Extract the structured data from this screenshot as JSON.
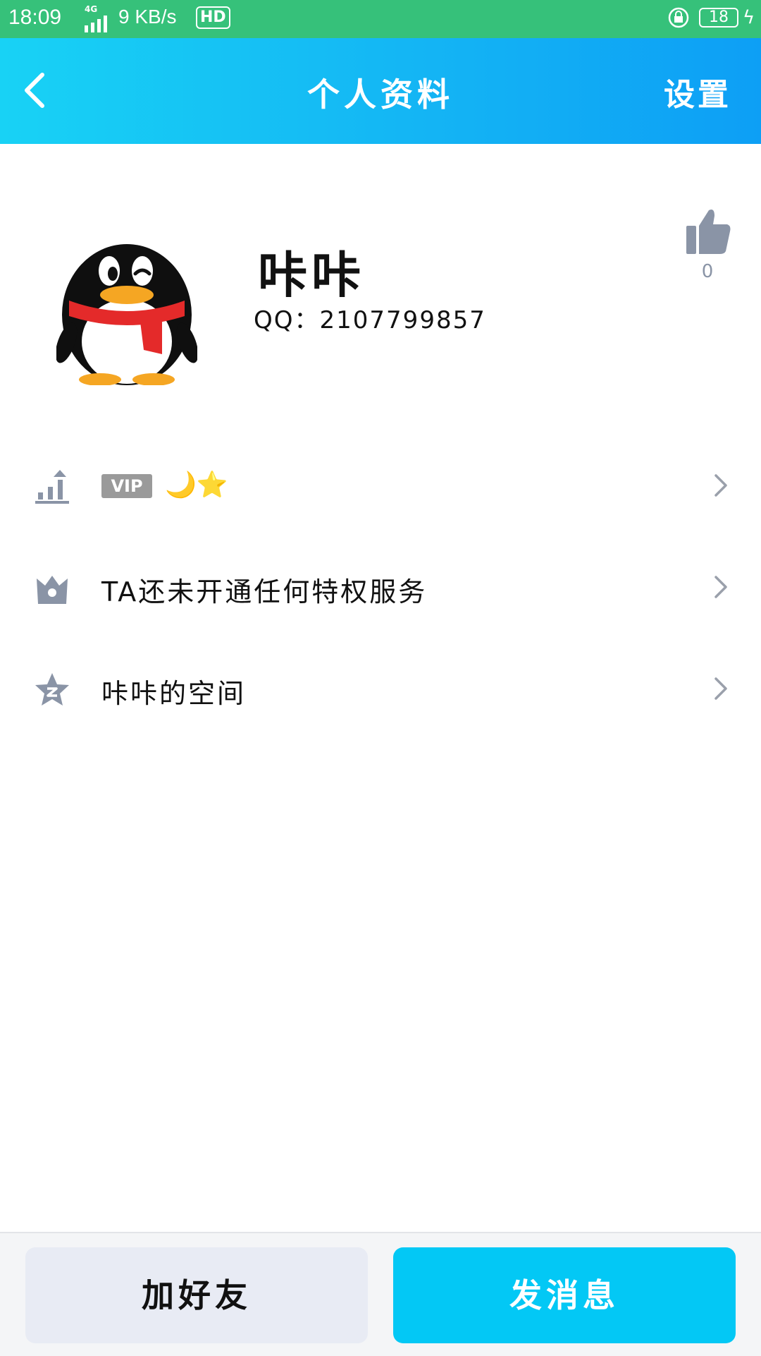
{
  "status_bar": {
    "time": "18:09",
    "network": "4G",
    "speed": "9 KB/s",
    "hd": "HD",
    "battery": "18"
  },
  "header": {
    "title": "个人资料",
    "settings": "设置",
    "accent": "#14b5f4"
  },
  "profile": {
    "name": "咔咔",
    "qq": "QQ：2107799857",
    "likes": "0"
  },
  "list": {
    "vip_badge": "VIP",
    "vip_level": "🌙⭐",
    "privilege": "TA还未开通任何特权服务",
    "space": "咔咔的空间"
  },
  "actions": {
    "add_friend": "加好友",
    "send_message": "发消息"
  }
}
